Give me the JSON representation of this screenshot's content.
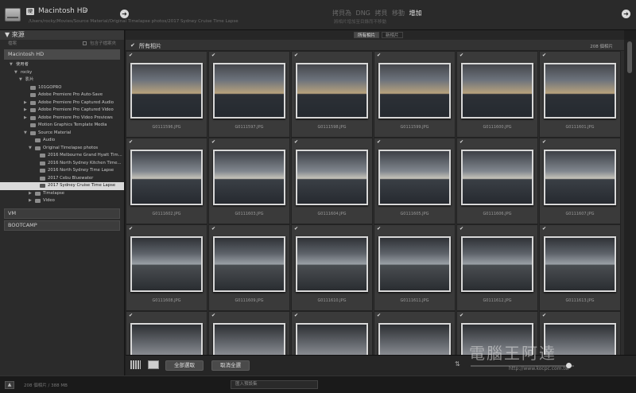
{
  "topbar": {
    "badge": "硬",
    "source_title": "Macintosh HD",
    "source_caret": "÷",
    "source_path": "/Users/rocky/Movies/Source Material/Original Timelapse photos/2017 Sydney Cruise Time Lapse",
    "modes": [
      "拷貝為 DNG",
      "拷貝",
      "移動",
      "增加"
    ],
    "active_mode": "增加",
    "modes_sub": "將相片增加至目錄而不移動",
    "arrow": "➜"
  },
  "left_panel": {
    "title": "▼ 來源",
    "files_label": "檔案",
    "include_subfolders": "包含子檔案夾",
    "volume_open": "Macintosh HD",
    "tree": [
      {
        "label": "使用者",
        "depth": 1,
        "tri": "▼",
        "folder": false
      },
      {
        "label": "rocky",
        "depth": 2,
        "tri": "▼",
        "folder": false
      },
      {
        "label": "影片",
        "depth": 3,
        "tri": "▼",
        "folder": false
      },
      {
        "label": "101GOPRO",
        "depth": 4,
        "tri": "",
        "folder": true
      },
      {
        "label": "Adobe Premiere Pro Auto-Save",
        "depth": 4,
        "tri": "",
        "folder": true
      },
      {
        "label": "Adobe Premiere Pro Captured Audio",
        "depth": 4,
        "tri": "▶",
        "folder": true
      },
      {
        "label": "Adobe Premiere Pro Captured Video",
        "depth": 4,
        "tri": "▶",
        "folder": true
      },
      {
        "label": "Adobe Premiere Pro Video Previews",
        "depth": 4,
        "tri": "▶",
        "folder": true
      },
      {
        "label": "Motion Graphics Template Media",
        "depth": 4,
        "tri": "",
        "folder": true
      },
      {
        "label": "Source Material",
        "depth": 4,
        "tri": "▼",
        "folder": true
      },
      {
        "label": "Audio",
        "depth": 5,
        "tri": "",
        "folder": true
      },
      {
        "label": "Original Timelapse photos",
        "depth": 5,
        "tri": "▼",
        "folder": true
      },
      {
        "label": "2016 Melbourne Grand Hyatt Tim...",
        "depth": 6,
        "tri": "",
        "folder": true
      },
      {
        "label": "2016 North Sydney Kitchen Time...",
        "depth": 6,
        "tri": "",
        "folder": true
      },
      {
        "label": "2016 North Sydney Time Lapse",
        "depth": 6,
        "tri": "",
        "folder": true
      },
      {
        "label": "2017 Cebu Bluewater",
        "depth": 6,
        "tri": "",
        "folder": true
      },
      {
        "label": "2017 Sydney Cruise Time Lapse",
        "depth": 6,
        "tri": "",
        "folder": true,
        "selected": true
      },
      {
        "label": "Timelapse",
        "depth": 5,
        "tri": "▶",
        "folder": true
      },
      {
        "label": "Video",
        "depth": 5,
        "tri": "▶",
        "folder": true
      }
    ],
    "volumes_closed": [
      "VM",
      "BOOTCAMP"
    ]
  },
  "main": {
    "tabs": [
      "所有相片",
      "新相片"
    ],
    "active_tab": "所有相片",
    "header_title": "所有相片",
    "count": "208 個相片",
    "rows": [
      [
        "G0111596.JPG",
        "G0111597.JPG",
        "G0111598.JPG",
        "G0111599.JPG",
        "G0111600.JPG",
        "G0111601.JPG"
      ],
      [
        "G0111602.JPG",
        "G0111603.JPG",
        "G0111604.JPG",
        "G0111605.JPG",
        "G0111606.JPG",
        "G0111607.JPG"
      ],
      [
        "G0111608.JPG",
        "G0111609.JPG",
        "G0111610.JPG",
        "G0111611.JPG",
        "G0111612.JPG",
        "G0111613.JPG"
      ],
      [
        "",
        "",
        "",
        "",
        "",
        ""
      ]
    ]
  },
  "toolbar": {
    "check_all": "全部選取",
    "uncheck_all": "取消全選",
    "sort_icon": "⇅",
    "watermark": "電腦王阿達",
    "watermark_url": "http://www.kocpc.com.tw"
  },
  "status": {
    "up_arrow": "▲",
    "info": "208 個相片 / 388 MB",
    "preset_placeholder": "匯入預設集"
  }
}
